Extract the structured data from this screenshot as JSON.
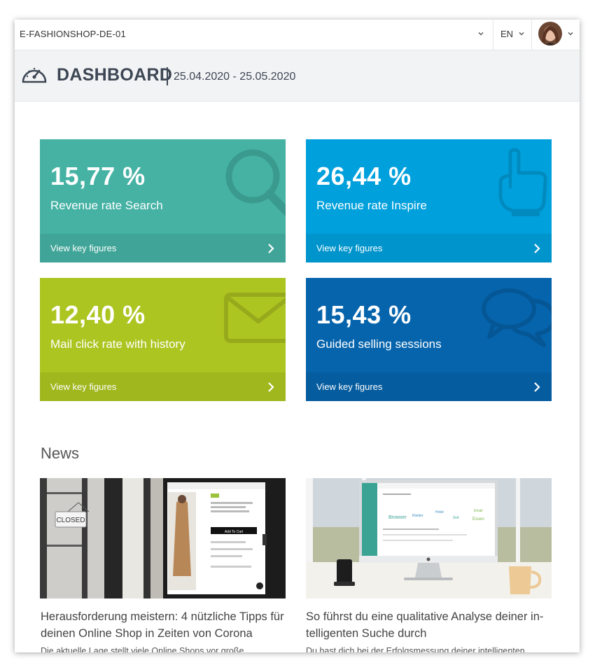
{
  "topbar": {
    "shop_name": "E-FASHIONSHOP-DE-01",
    "language": "EN"
  },
  "header": {
    "title": "DASHBOARD",
    "date_range": "25.04.2020 - 25.05.2020"
  },
  "tiles": [
    {
      "value": "15,77 %",
      "label": "Revenue rate Search",
      "link": "View key figures",
      "color": "#45b2a4",
      "icon": "magnifier-icon"
    },
    {
      "value": "26,44 %",
      "label": "Revenue rate Inspire",
      "link": "View key figures",
      "color": "#00a0dc",
      "icon": "pointing-hand-icon"
    },
    {
      "value": "12,40 %",
      "label": "Mail click rate with history",
      "link": "View key figures",
      "color": "#adc521",
      "icon": "envelope-icon"
    },
    {
      "value": "15,43 %",
      "label": "Guided selling sessions",
      "link": "View key figures",
      "color": "#0664ac",
      "icon": "speech-bubbles-icon"
    }
  ],
  "news": {
    "title": "News",
    "items": [
      {
        "headline": "Herausforderung meistern: 4 nützliche Tipps für deinen Online Shop in Zeiten von Corona",
        "teaser": "Die aktuelle Lage stellt viele Online Shops vor große",
        "image_sign": "CLOSED",
        "image_button": "Add To Cart"
      },
      {
        "headline": "So führst du eine qualitative Analyse deiner in-telligenten Suche durch",
        "teaser": "Du hast dich bei der Erfolgsmessung deiner intelligenten",
        "image_words": [
          "Browser",
          "Kleider",
          "Email",
          "Essen",
          "Hotel",
          "Zeit"
        ]
      }
    ]
  }
}
